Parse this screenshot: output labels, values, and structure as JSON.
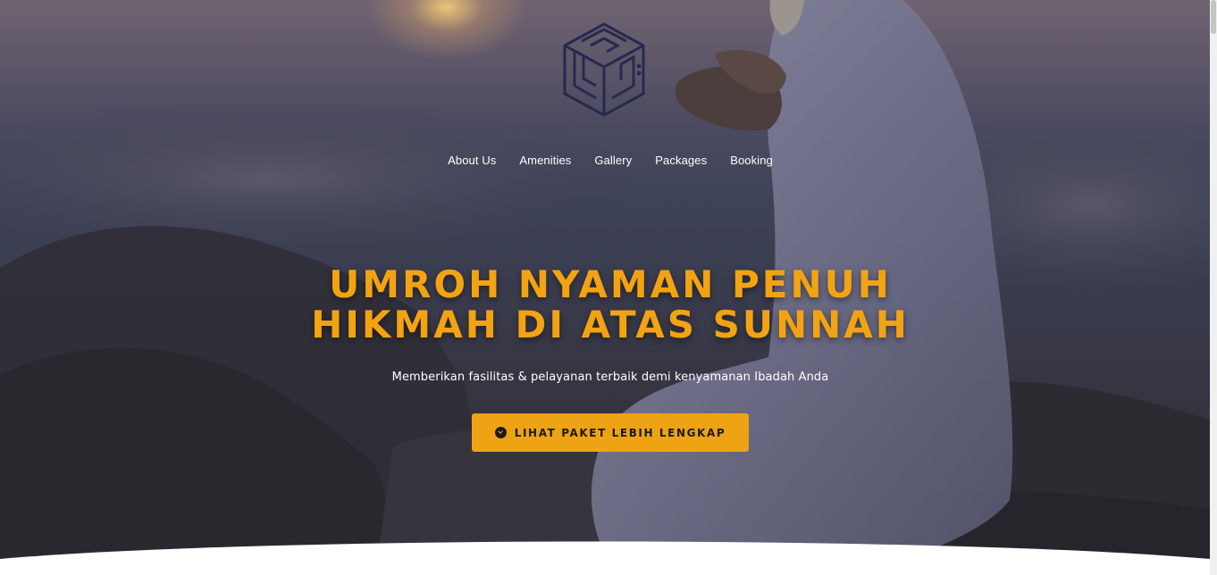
{
  "brand": {
    "logo_icon": "kaaba-cube-logo-icon",
    "logo_color": "#262a4f"
  },
  "nav": {
    "items": [
      {
        "label": "About Us"
      },
      {
        "label": "Amenities"
      },
      {
        "label": "Gallery"
      },
      {
        "label": "Packages"
      },
      {
        "label": "Booking"
      }
    ]
  },
  "hero": {
    "headline_line1": "UMROH NYAMAN PENUH",
    "headline_line2": "HIKMAH DI ATAS SUNNAH",
    "subtitle": "Memberikan fasilitas & pelayanan terbaik demi kenyamanan Ibadah Anda",
    "cta_label": "LIHAT PAKET LEBIH LENGKAP",
    "cta_icon": "arrow-circle-down-icon"
  },
  "colors": {
    "accent": "#eda314",
    "headline": "#f3a312",
    "nav_text": "#ffffff"
  }
}
